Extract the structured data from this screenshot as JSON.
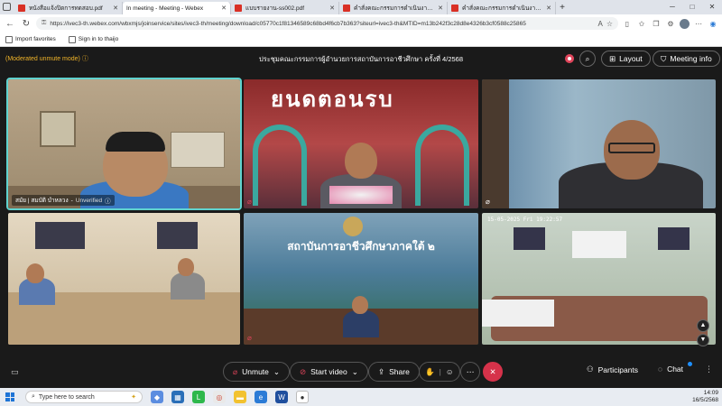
{
  "browser": {
    "tabs": [
      {
        "title": "หนังสือแจ้งปิดการทดสอบ.pdf",
        "icon": "pdf-icon",
        "active": false
      },
      {
        "title": "In meeting - Meeting - Webex",
        "icon": "webex-icon",
        "active": true
      },
      {
        "title": "แบบรายงาน-ss002.pdf",
        "icon": "pdf-icon",
        "active": false
      },
      {
        "title": "คำสั่งคณะกรรมการดำเนินงาน.pdf",
        "icon": "pdf-icon",
        "active": false
      },
      {
        "title": "คำสั่งคณะกรรมการดำเนินงาน.pdf",
        "icon": "pdf-icon",
        "active": false
      }
    ],
    "new_tab": "+",
    "window_controls": {
      "minimize": "─",
      "maximize": "□",
      "close": "✕"
    },
    "url": "https://ivec3-th.webex.com/wbxmjs/joinservice/sites/ivec3-th/meeting/download/c05770c1f81346589c68bd4f6cb7b363?siteurl=ivec3-th&MTID=m13b242f3c28d8e4326b3cf0588c25865",
    "favorites": [
      {
        "label": "Import favorites",
        "icon": "import-icon"
      },
      {
        "label": "Sign in to thaijo",
        "icon": "bookmark-icon"
      }
    ]
  },
  "webex": {
    "moderated_label": "(Moderated unmute mode)",
    "meeting_title": "ประชุมคณะกรรมการผู้อำนวยการสถาบันการอาชีวศึกษา ครั้งที่ 4/2568",
    "layout_label": "Layout",
    "meeting_info_label": "Meeting info",
    "tiles": [
      {
        "name": "สมัย | สมบัติ บำหลวง",
        "status": "Unverified",
        "active_speaker": true
      },
      {
        "banner": "ยนดตอนรบ"
      },
      {},
      {},
      {
        "banner": "สถาบันการอาชีวศึกษาภาคใต้ ๒"
      },
      {
        "timestamp": "15-05-2025 Fri 19:22:57"
      }
    ],
    "controls": {
      "unmute": "Unmute",
      "start_video": "Start video",
      "share": "Share",
      "participants": "Participants",
      "chat": "Chat"
    }
  },
  "taskbar": {
    "search_placeholder": "Type here to search",
    "time": "14:09",
    "date": "16/5/2568"
  },
  "colors": {
    "accent_speaker": "#5fd3cf",
    "moderated_text": "#f0b429",
    "leave_red": "#d6324a"
  }
}
